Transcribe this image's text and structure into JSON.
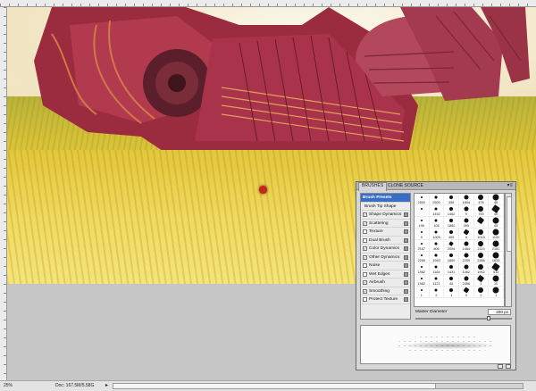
{
  "status_bar": {
    "zoom": "25%",
    "doc": "Doc: 167.5M/5.58G",
    "arrow": "▸"
  },
  "brushes_panel": {
    "tabs": [
      {
        "label": "BRUSHES",
        "active": true
      },
      {
        "label": "CLONE SOURCE",
        "active": false
      }
    ],
    "menu_glyph": "▾≡",
    "list": [
      {
        "label": "Brush Presets",
        "selected": true,
        "checkbox": false,
        "checked": false,
        "lock": false
      },
      {
        "label": "Brush Tip Shape",
        "selected": false,
        "checkbox": false,
        "checked": false,
        "lock": false
      },
      {
        "label": "Shape Dynamics",
        "selected": false,
        "checkbox": true,
        "checked": true,
        "lock": true
      },
      {
        "label": "Scattering",
        "selected": false,
        "checkbox": true,
        "checked": true,
        "lock": true
      },
      {
        "label": "Texture",
        "selected": false,
        "checkbox": true,
        "checked": false,
        "lock": true
      },
      {
        "label": "Dual Brush",
        "selected": false,
        "checkbox": true,
        "checked": false,
        "lock": true
      },
      {
        "label": "Color Dynamics",
        "selected": false,
        "checkbox": true,
        "checked": true,
        "lock": true
      },
      {
        "label": "Other Dynamics",
        "selected": false,
        "checkbox": true,
        "checked": true,
        "lock": true
      },
      {
        "label": "Noise",
        "selected": false,
        "checkbox": true,
        "checked": false,
        "lock": true
      },
      {
        "label": "Wet Edges",
        "selected": false,
        "checkbox": true,
        "checked": false,
        "lock": true
      },
      {
        "label": "Airbrush",
        "selected": false,
        "checkbox": true,
        "checked": true,
        "lock": true
      },
      {
        "label": "Smoothing",
        "selected": false,
        "checkbox": true,
        "checked": true,
        "lock": true
      },
      {
        "label": "Protect Texture",
        "selected": false,
        "checkbox": true,
        "checked": false,
        "lock": true
      }
    ],
    "brush_sizes": [
      "2500",
      "2500",
      "358",
      "1804",
      "478",
      "46",
      "",
      "1452",
      "1462",
      "9",
      "700",
      "40",
      "196",
      "108",
      "1860",
      "395",
      "",
      "45",
      "9",
      "1005",
      "455",
      "5",
      "1015",
      "1100",
      "2167",
      "806",
      "2094",
      "1464",
      "2119",
      "2181",
      "2289",
      "1983",
      "1860",
      "2259",
      "2386",
      "1833",
      "1982",
      "1164",
      "1431",
      "1462",
      "1962",
      "513",
      "1982",
      "1121",
      "46",
      "2456",
      "1",
      "10",
      "1",
      "2",
      "1",
      "3",
      "2",
      "1"
    ],
    "master_diameter_label": "Master Diameter",
    "master_diameter_value": "200 px",
    "check_glyph": "✓"
  }
}
